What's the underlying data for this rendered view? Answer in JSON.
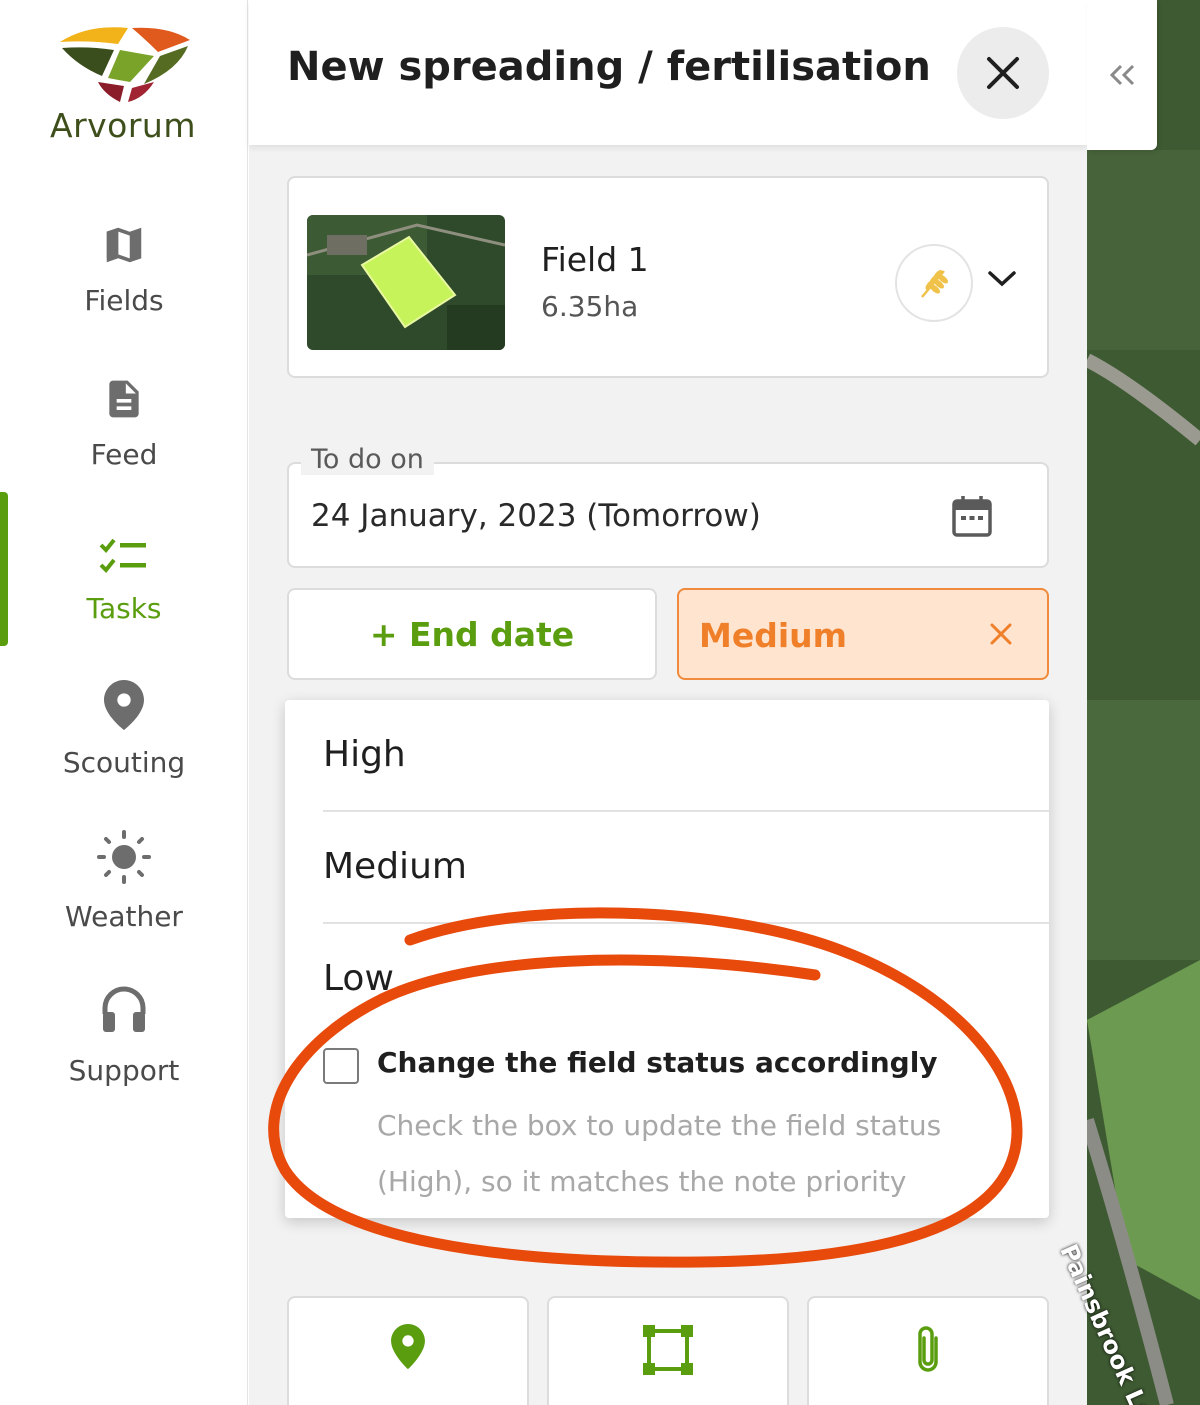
{
  "app": {
    "brand": "Arvorum"
  },
  "sidebar": {
    "items": [
      {
        "label": "Fields",
        "icon": "map-icon"
      },
      {
        "label": "Feed",
        "icon": "document-icon"
      },
      {
        "label": "Tasks",
        "icon": "checklist-icon",
        "active": true
      },
      {
        "label": "Scouting",
        "icon": "pin-icon"
      },
      {
        "label": "Weather",
        "icon": "sun-icon"
      },
      {
        "label": "Support",
        "icon": "headset-icon"
      }
    ]
  },
  "panel": {
    "title": "New spreading / fertilisation",
    "field": {
      "name": "Field 1",
      "area": "6.35ha",
      "crop_icon": "wheat-icon"
    },
    "date": {
      "legend": "To do on",
      "value": "24 January, 2023 (Tomorrow)"
    },
    "end_date_label": "+ End date",
    "priority": {
      "selected": "Medium"
    },
    "priority_options": [
      "High",
      "Medium",
      "Low"
    ],
    "status_checkbox": {
      "label": "Change the field status accordingly",
      "help": "Check the box to update the field status (High), so it matches the note priority",
      "checked": false
    },
    "tools": [
      "location-icon",
      "polygon-icon",
      "attachment-icon"
    ]
  },
  "map": {
    "road_label": "Painsbrook Ln"
  },
  "colors": {
    "brand_green": "#5a9e0f",
    "priority_orange": "#f07f2a",
    "annotation_red": "#e84a0c"
  }
}
